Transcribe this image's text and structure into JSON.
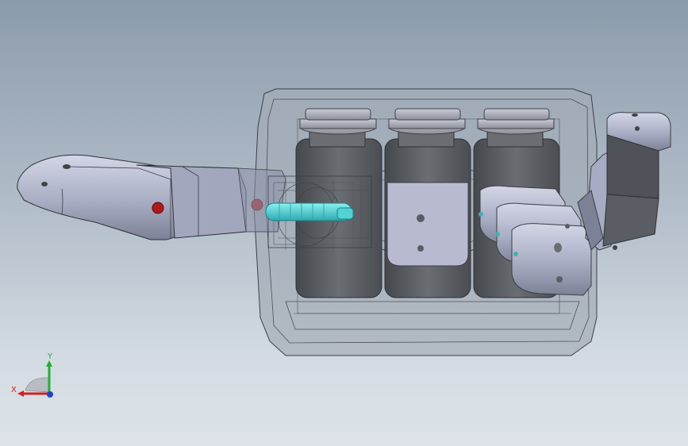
{
  "viewport": {
    "background_top": "#8c9bab",
    "background_bottom": "#dde3e8"
  },
  "model": {
    "description_icon": "robotic-hand-assembly-icon",
    "colors": {
      "shell": "#9aa3ad",
      "shell_outline": "#3a3f46",
      "finger": "#b9bdd4",
      "servo": "#55585d",
      "servo_cap": "#a9acb6",
      "joint_pin": "#b01a1a",
      "cyan_part": "#4fd4d4",
      "tip_hole": "#3fb3b3"
    }
  },
  "triad": {
    "x_label": "X",
    "y_label": "Y",
    "x_color": "#d02020",
    "y_color": "#20b030",
    "z_color": "#2040d0"
  }
}
